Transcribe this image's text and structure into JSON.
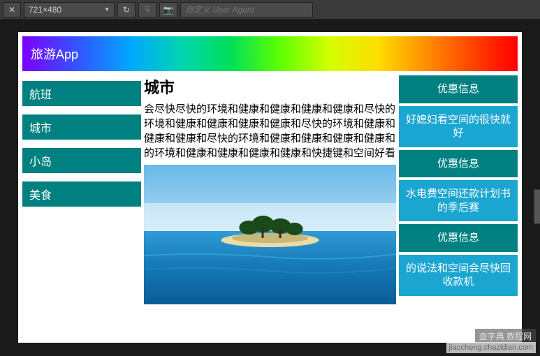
{
  "toolbar": {
    "close_icon": "✕",
    "resolution": "721×480",
    "refresh_icon": "↻",
    "touch_icon": "☟",
    "camera_icon": "📷",
    "ua_placeholder": "自定义 User Agent"
  },
  "header": {
    "title": "旅游App"
  },
  "nav": {
    "items": [
      {
        "label": "航班"
      },
      {
        "label": "城市"
      },
      {
        "label": "小岛"
      },
      {
        "label": "美食"
      }
    ]
  },
  "main": {
    "title": "城市",
    "body": "会尽快尽快的环境和健康和健康和健康和健康和尽快的环境和健康和健康和健康和健康和尽快的环境和健康和健康和健康和尽快的环境和健康和健康和健康和健康和的环境和健康和健康和健康和健康和快捷键和空间好看"
  },
  "right": {
    "items": [
      {
        "label": "优惠信息",
        "dark": true
      },
      {
        "label": "好媳妇看空间的很快就好"
      },
      {
        "label": "优惠信息",
        "dark": true
      },
      {
        "label": "水电费空间还款计划书的季后赛"
      },
      {
        "label": "优惠信息",
        "dark": true
      },
      {
        "label": "的说法和空间会尽快回收款机"
      }
    ]
  },
  "watermark": {
    "site": "jiaocheng.chazidian.com",
    "brand": "查字典 教程网"
  }
}
